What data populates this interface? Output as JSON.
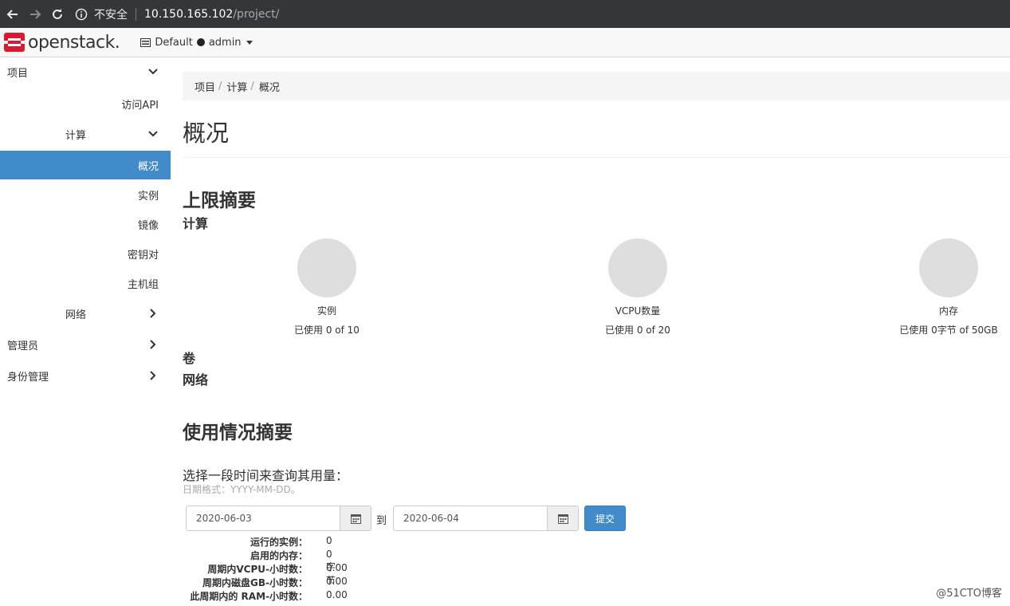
{
  "browser": {
    "security_label": "不安全",
    "url_host": "10.150.165.102",
    "url_path": "/project/"
  },
  "topnav": {
    "logo_text": "openstack.",
    "domain": "Default",
    "user": "admin"
  },
  "sidebar": {
    "items": [
      {
        "label": "项目",
        "chevron": "down"
      },
      {
        "label": "访问API"
      },
      {
        "label": "计算",
        "chevron": "down"
      },
      {
        "label": "概况",
        "active": true
      },
      {
        "label": "实例"
      },
      {
        "label": "镜像"
      },
      {
        "label": "密钥对"
      },
      {
        "label": "主机组"
      },
      {
        "label": "网络",
        "chevron": "right"
      },
      {
        "label": "管理员",
        "chevron": "right"
      },
      {
        "label": "身份管理",
        "chevron": "right"
      }
    ]
  },
  "breadcrumb": [
    "项目",
    "计算",
    "概况"
  ],
  "page_title": "概况",
  "limits": {
    "heading": "上限摘要",
    "compute_heading": "计算",
    "charts": [
      {
        "title": "实例",
        "usage": "已使用 0 of 10"
      },
      {
        "title": "VCPU数量",
        "usage": "已使用 0 of 20"
      },
      {
        "title": "内存",
        "usage": "已使用 0字节 of 50GB"
      }
    ],
    "volume_heading": "卷",
    "network_heading": "网络"
  },
  "usage": {
    "heading": "使用情况摘要",
    "query_label": "选择一段时间来查询其用量：",
    "date_help": "日期格式：YYYY-MM-DD。",
    "start_date": "2020-06-03",
    "to_label": "到",
    "end_date": "2020-06-04",
    "submit_label": "提交",
    "stats": [
      {
        "key": "运行的实例：",
        "value": "0"
      },
      {
        "key": "启用的内存：",
        "value": "0字节"
      },
      {
        "key": "周期内VCPU-小时数：",
        "value": "0.00"
      },
      {
        "key": "周期内磁盘GB-小时数：",
        "value": "0.00"
      },
      {
        "key": "此周期内的 RAM-小时数：",
        "value": "0.00"
      }
    ]
  },
  "watermark": "@51CTO博客",
  "colors": {
    "primary": "#428bca",
    "chrome_bg": "#35363a",
    "pie_fill": "#dedede",
    "logo_red": "#da1a32"
  }
}
